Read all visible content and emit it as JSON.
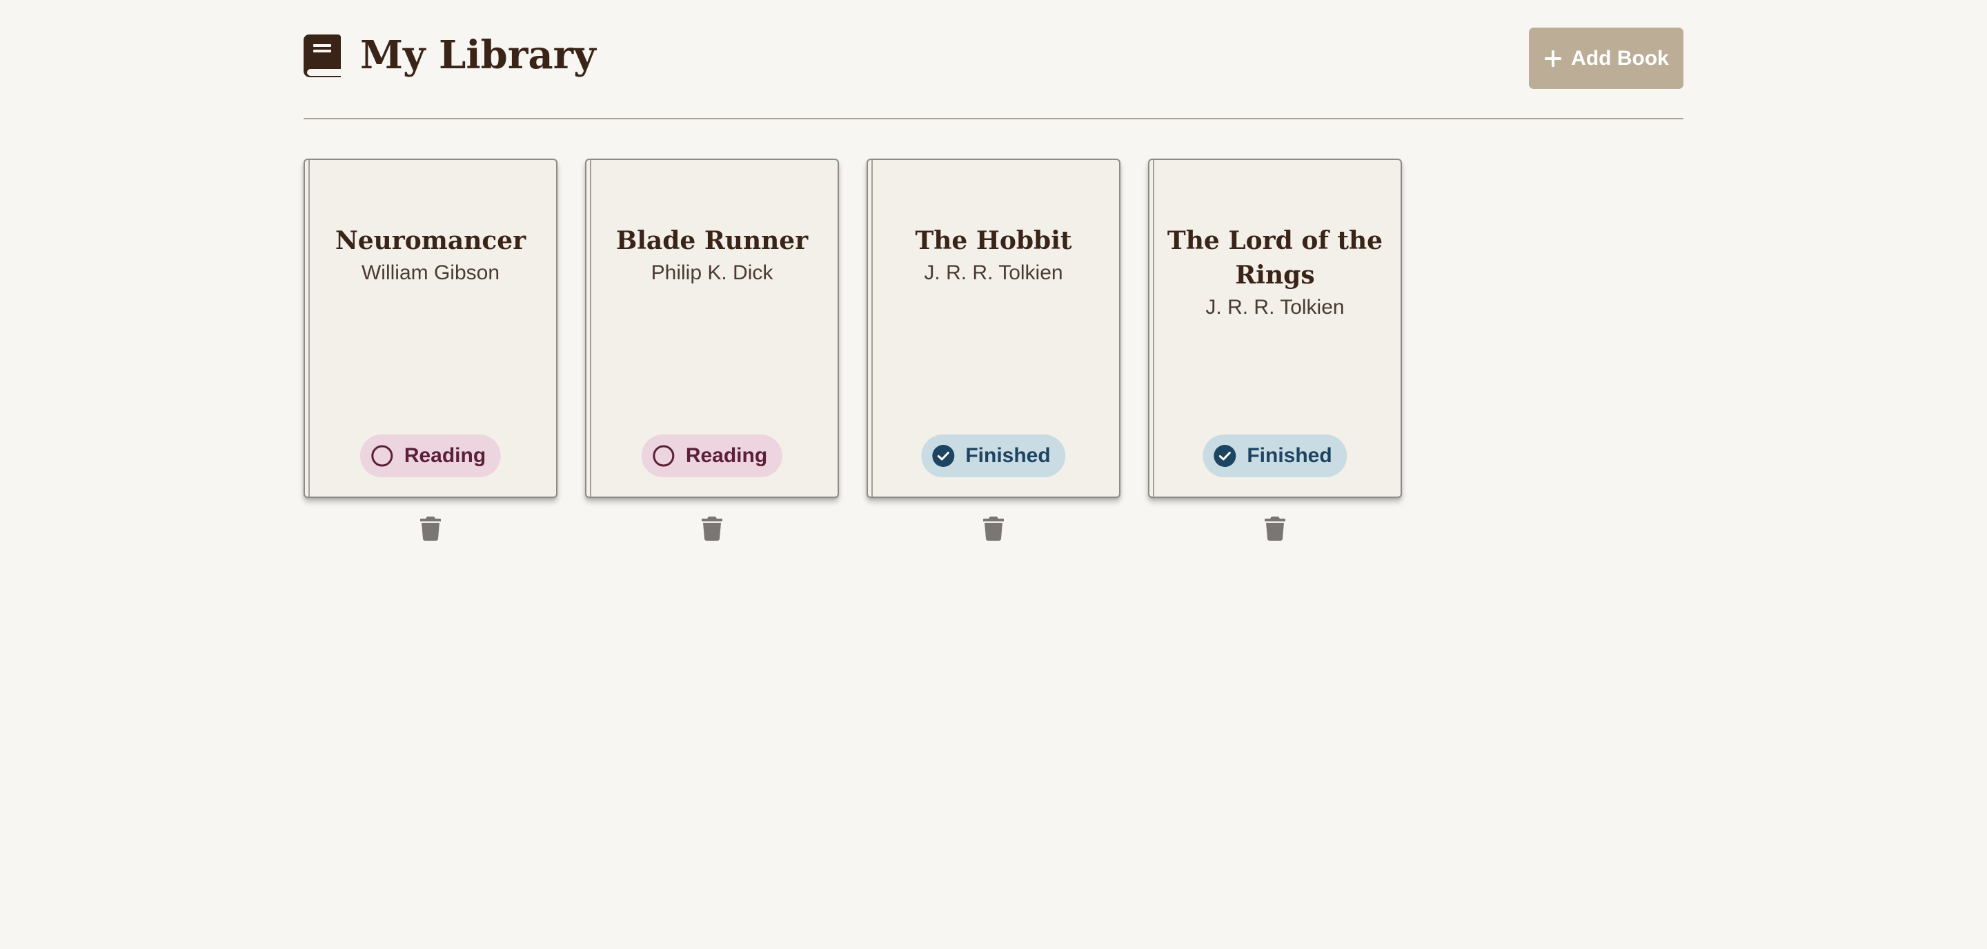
{
  "header": {
    "title": "My Library",
    "logo_icon": "book-icon",
    "add_button_label": "Add Book",
    "add_button_icon": "plus-icon"
  },
  "colors": {
    "background": "#f8f6f2",
    "title_text": "#3a2417",
    "add_button_bg": "#bcad97",
    "reading_badge_bg": "#ecd5de",
    "reading_badge_text": "#5b1f3a",
    "finished_badge_bg": "#c9dbe3",
    "finished_badge_text": "#1d4460",
    "trash_icon": "#7a7673"
  },
  "books": [
    {
      "title": "Neuromancer",
      "author": "William Gibson",
      "status": "Reading",
      "status_icon": "empty-circle-icon",
      "delete_icon": "trash-icon"
    },
    {
      "title": "Blade Runner",
      "author": "Philip K. Dick",
      "status": "Reading",
      "status_icon": "empty-circle-icon",
      "delete_icon": "trash-icon"
    },
    {
      "title": "The Hobbit",
      "author": "J. R. R. Tolkien",
      "status": "Finished",
      "status_icon": "check-circle-icon",
      "delete_icon": "trash-icon"
    },
    {
      "title": "The Lord of the Rings",
      "author": "J. R. R. Tolkien",
      "status": "Finished",
      "status_icon": "check-circle-icon",
      "delete_icon": "trash-icon"
    }
  ]
}
